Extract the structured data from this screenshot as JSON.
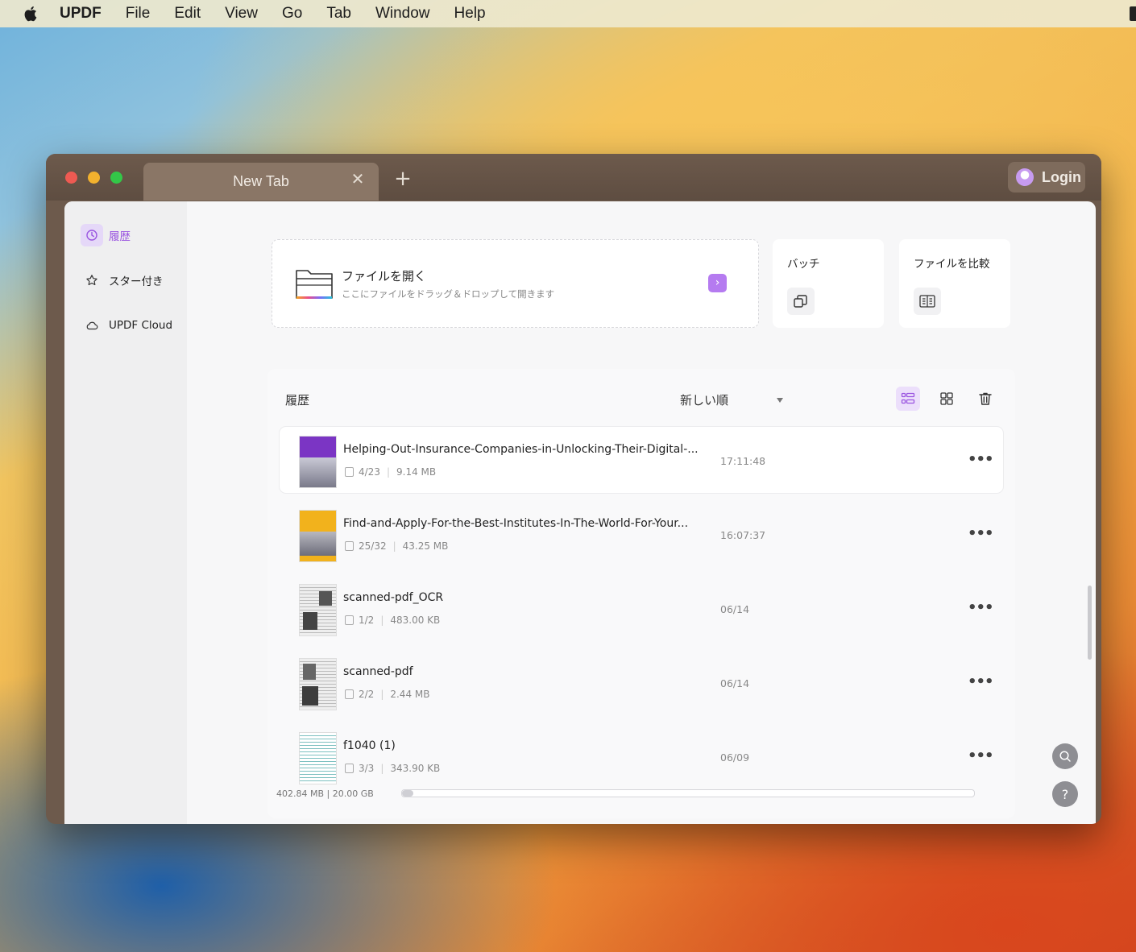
{
  "menubar": {
    "app_name": "UPDF",
    "items": [
      "File",
      "Edit",
      "View",
      "Go",
      "Tab",
      "Window",
      "Help"
    ]
  },
  "window": {
    "tab_label": "New Tab",
    "login_label": "Login"
  },
  "sidebar": {
    "items": [
      {
        "label": "履歴",
        "icon": "clock-icon",
        "active": true
      },
      {
        "label": "スター付き",
        "icon": "star-icon",
        "active": false
      },
      {
        "label": "UPDF Cloud",
        "icon": "cloud-icon",
        "active": false
      }
    ]
  },
  "open_file": {
    "title": "ファイルを開く",
    "subtitle": "ここにファイルをドラッグ＆ドロップして開きます",
    "go_symbol": "›"
  },
  "tools": {
    "batch_label": "バッチ",
    "compare_label": "ファイルを比較"
  },
  "history": {
    "title": "履歴",
    "sort_label": "新しい順",
    "files": [
      {
        "name": "Helping-Out-Insurance-Companies-in-Unlocking-Their-Digital-...",
        "pages": "4/23",
        "size": "9.14 MB",
        "time": "17:11:48",
        "thumb_color": "#7b35c4"
      },
      {
        "name": "Find-and-Apply-For-the-Best-Institutes-In-The-World-For-Your...",
        "pages": "25/32",
        "size": "43.25 MB",
        "time": "16:07:37",
        "thumb_color": "#f2b21c"
      },
      {
        "name": "scanned-pdf_OCR",
        "pages": "1/2",
        "size": "483.00 KB",
        "time": "06/14",
        "thumb_color": "#8a8a8a"
      },
      {
        "name": "scanned-pdf",
        "pages": "2/2",
        "size": "2.44 MB",
        "time": "06/14",
        "thumb_color": "#8a8a8a"
      },
      {
        "name": "f1040 (1)",
        "pages": "3/3",
        "size": "343.90 KB",
        "time": "06/09",
        "thumb_color": "#3a8a8a"
      }
    ],
    "more_symbol": "•••"
  },
  "storage": {
    "text": "402.84 MB | 20.00 GB",
    "fraction": 0.0197
  },
  "fab": {
    "help_symbol": "?"
  },
  "colors": {
    "accent": "#9a55e0",
    "accent_bg": "#e5d8f8",
    "window_chrome": "#6d5a4c"
  }
}
